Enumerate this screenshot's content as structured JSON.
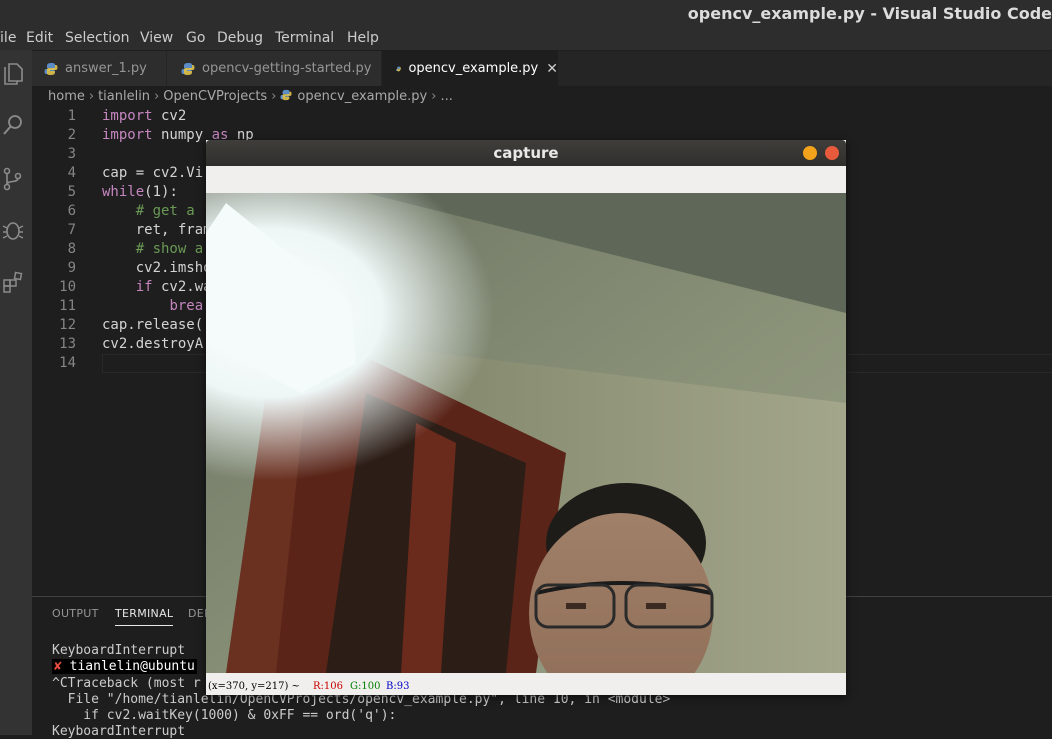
{
  "window": {
    "title": "opencv_example.py - Visual Studio Code"
  },
  "menu": [
    "File",
    "Edit",
    "Selection",
    "View",
    "Go",
    "Debug",
    "Terminal",
    "Help"
  ],
  "activity_icons": [
    "explorer-icon",
    "search-icon",
    "source-control-icon",
    "debug-icon",
    "extensions-icon"
  ],
  "tabs": [
    {
      "label": "answer_1.py"
    },
    {
      "label": "opencv-getting-started.py"
    },
    {
      "label": "opencv_example.py",
      "close": "✕"
    }
  ],
  "breadcrumb": {
    "items": [
      "home",
      "tianlelin",
      "OpenCVProjects",
      "opencv_example.py",
      "..."
    ],
    "sep": "›"
  },
  "code": {
    "line_numbers": [
      "1",
      "2",
      "3",
      "4",
      "5",
      "6",
      "7",
      "8",
      "9",
      "10",
      "11",
      "12",
      "13",
      "14"
    ],
    "lines": [
      [
        {
          "t": "import",
          "c": "kw"
        },
        {
          "t": " cv2"
        }
      ],
      [
        {
          "t": "import",
          "c": "kw"
        },
        {
          "t": " numpy "
        },
        {
          "t": "as",
          "c": "kw"
        },
        {
          "t": " np"
        }
      ],
      [],
      [
        {
          "t": "cap = cv2.Vi"
        }
      ],
      [
        {
          "t": "while",
          "c": "kw"
        },
        {
          "t": "(1):"
        }
      ],
      [
        {
          "t": "    "
        },
        {
          "t": "# get a",
          "c": "cm"
        }
      ],
      [
        {
          "t": "    ret, fram"
        }
      ],
      [
        {
          "t": "    "
        },
        {
          "t": "# show a",
          "c": "cm"
        }
      ],
      [
        {
          "t": "    cv2.imsho"
        }
      ],
      [
        {
          "t": "    "
        },
        {
          "t": "if",
          "c": "kw"
        },
        {
          "t": " cv2.wa"
        }
      ],
      [
        {
          "t": "        "
        },
        {
          "t": "brea",
          "c": "kw"
        }
      ],
      [
        {
          "t": "cap.release("
        }
      ],
      [
        {
          "t": "cv2.destroyA"
        }
      ],
      []
    ]
  },
  "panel": {
    "tabs": [
      "OUTPUT",
      "TERMINAL",
      "DEB"
    ],
    "active_tab": "TERMINAL",
    "terminal": {
      "line1": "KeyboardInterrupt",
      "prompt_mark": "✘",
      "prompt_text": "tianlelin@ubuntu",
      "line3": "^CTraceback (most r",
      "line4": "  File \"/home/tianlelin/OpenCVProjects/opencv_example.py\", line 10, in <module>",
      "line5": "    if cv2.waitKey(1000) & 0xFF == ord('q'):",
      "line6": "KeyboardInterrupt"
    }
  },
  "capture": {
    "title": "capture",
    "status": {
      "coords": "(x=370, y=217) ~",
      "r": "R:106",
      "g": "G:100",
      "b": "B:93"
    }
  },
  "colors": {
    "keyword": "#c586c0",
    "comment": "#6a9955",
    "editor_bg": "#1e1e1e",
    "status_r": "#c80000",
    "status_g": "#008000",
    "status_b": "#0000c8"
  }
}
